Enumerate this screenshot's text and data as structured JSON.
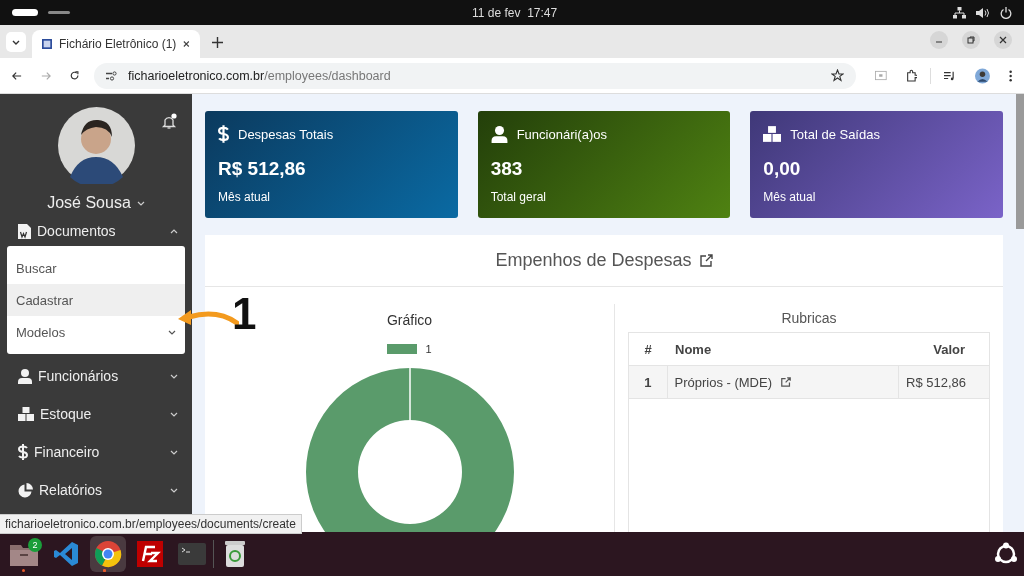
{
  "system_bar": {
    "date": "11 de fev",
    "time": "17:47"
  },
  "browser": {
    "tab": {
      "title": "Fichário Eletrônico (1)",
      "selected": true
    },
    "url": {
      "domain": "ficharioeletronico.com.br",
      "path": "/employees/dashboard"
    },
    "status_url": "ficharioeletronico.com.br/employees/documents/create"
  },
  "sidebar": {
    "user": {
      "name": "José Sousa"
    },
    "items": [
      {
        "label": "Documentos",
        "expanded": true
      },
      {
        "label": "Funcionários",
        "expanded": false
      },
      {
        "label": "Estoque",
        "expanded": false
      },
      {
        "label": "Financeiro",
        "expanded": false
      },
      {
        "label": "Relatórios",
        "expanded": false
      }
    ],
    "submenu": [
      {
        "label": "Buscar",
        "kind": "link",
        "selected": false
      },
      {
        "label": "Cadastrar",
        "kind": "link",
        "selected": true
      },
      {
        "label": "Modelos",
        "kind": "group",
        "selected": false
      }
    ]
  },
  "cards": [
    {
      "kind": "expenses",
      "title": "Despesas Totais",
      "value": "R$ 512,86",
      "caption": "Mês atual"
    },
    {
      "kind": "employees",
      "title": "Funcionári(a)os",
      "value": "383",
      "caption": "Total geral"
    },
    {
      "kind": "outputs",
      "title": "Total de Saídas",
      "value": "0,00",
      "caption": "Mês atual"
    }
  ],
  "panel": {
    "title": "Empenhos de Despesas",
    "chart": {
      "title": "Gráfico",
      "legend": [
        "1"
      ]
    },
    "table": {
      "title": "Rubricas",
      "columns": [
        "#",
        "Nome",
        "Valor"
      ],
      "rows": [
        {
          "cells": [
            "1",
            "Próprios - (MDE)",
            "R$ 512,86"
          ]
        }
      ]
    }
  },
  "annotation": {
    "label": "1"
  },
  "taskbar": {
    "apps": [
      {
        "kind": "files",
        "badge": "2",
        "running": true,
        "selected": false
      },
      {
        "kind": "code",
        "running": false,
        "selected": false
      },
      {
        "kind": "browser",
        "running": true,
        "selected": true
      },
      {
        "kind": "ftp",
        "running": false,
        "selected": false
      },
      {
        "kind": "terminal",
        "running": false,
        "selected": false
      },
      {
        "kind": "trash",
        "running": false,
        "selected": false
      }
    ]
  }
}
